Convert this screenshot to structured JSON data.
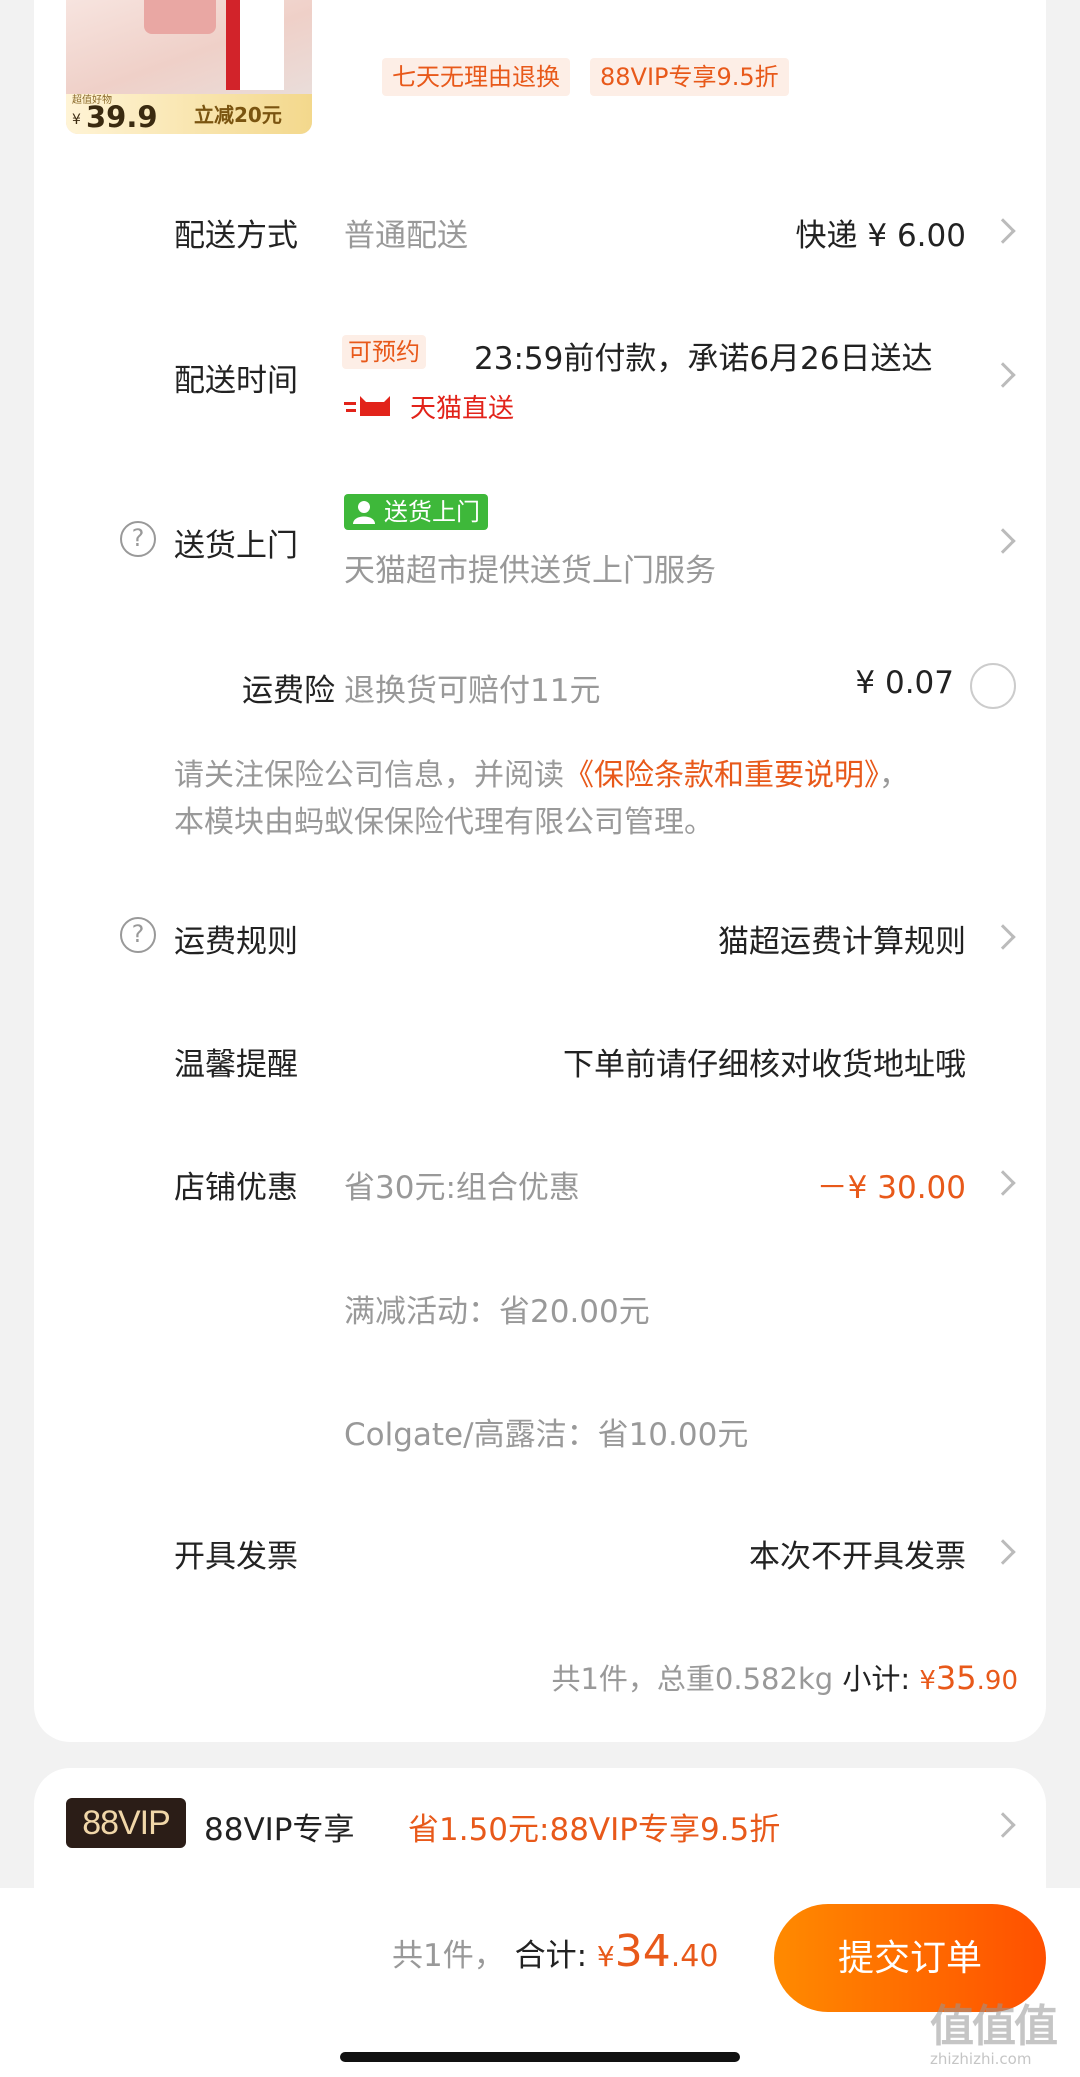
{
  "product": {
    "thumb_badge": "超值好物",
    "thumb_yen": "¥",
    "thumb_price": "39.9",
    "thumb_discount": "立减20元",
    "tags": [
      "七天无理由退换",
      "88VIP专享9.5折"
    ]
  },
  "delivery_method": {
    "label": "配送方式",
    "value": "普通配送",
    "right": "快递 ¥ 6.00"
  },
  "delivery_time": {
    "label": "配送时间",
    "pill": "可预约",
    "text": "23:59前付款，承诺6月26日送达",
    "service": "天猫直送"
  },
  "home_delivery": {
    "label": "送货上门",
    "tag": "送货上门",
    "desc": "天猫超市提供送货上门服务"
  },
  "shipping_insurance": {
    "label": "运费险",
    "value": "退换货可赔付11元",
    "price": "¥ 0.07",
    "note_line1_prefix": "请关注保险公司信息，并阅读",
    "note_link": "《保险条款和重要说明》",
    "note_line1_suffix": "，",
    "note_line2": "本模块由蚂蚁保保险代理有限公司管理。"
  },
  "freight_rule": {
    "label": "运费规则",
    "value": "猫超运费计算规则"
  },
  "reminder": {
    "label": "温馨提醒",
    "value": "下单前请仔细核对收货地址哦"
  },
  "store_discount": {
    "label": "店铺优惠",
    "value": "省30元:组合优惠",
    "amount": "－¥ 30.00",
    "details": [
      "满减活动：省20.00元",
      "Colgate/高露洁：省10.00元"
    ]
  },
  "invoice": {
    "label": "开具发票",
    "value": "本次不开具发票"
  },
  "subtotal": {
    "summary": "共1件，总重0.582kg",
    "label": "小计:",
    "yen": "¥",
    "int": "35",
    "dec": ".90"
  },
  "vip": {
    "badge": "88VIP",
    "label": "88VIP专享",
    "value": "省1.50元:88VIP专享9.5折"
  },
  "footer": {
    "count": "共1件，",
    "total_label": "合计:",
    "yen": "¥",
    "int": "34",
    "dec": ".40",
    "submit": "提交订单"
  },
  "watermark": {
    "main": "值值值",
    "sub": "zhizhizhi.com"
  },
  "colors": {
    "accent": "#e8591a",
    "button_start": "#ff8a00",
    "button_end": "#ff5000",
    "green": "#3eb83a",
    "tmall_red": "#e2231a"
  }
}
